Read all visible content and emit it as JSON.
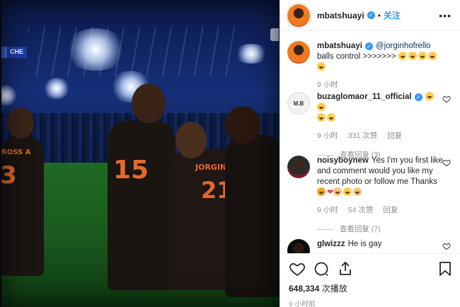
{
  "post": {
    "username": "mbatshuayi",
    "follow_label": "关注",
    "more_label": "•••",
    "dot": "•"
  },
  "media": {
    "score_team_a": "",
    "score_team_b": "CHE",
    "shirt_number_left": "3",
    "shirt_name_left": "ROSS A",
    "shirt_number_center": "15",
    "shirt_name_right": "JORGINHO",
    "shirt_number_right": "21"
  },
  "caption": {
    "username": "mbatshuayi",
    "mention": "@jorginhofrello",
    "text": " balls control >>>>>>> ",
    "time": "9 小时"
  },
  "comments": [
    {
      "username": "buzaglomaor_11_official",
      "text": "",
      "time": "9 小时",
      "likes": "331 次赞",
      "reply": "回复",
      "view_replies": "查看回复 (3)"
    },
    {
      "username": "noisyboynew",
      "text": "Yes I'm you first like and comment  would you like my recent photo  or follow me Thanks ",
      "time": "9 小时",
      "likes": "54 次赞",
      "reply": "回复",
      "view_replies": "查看回复 (7)"
    },
    {
      "username": "glwizzz",
      "text": "He is gay"
    }
  ],
  "footer": {
    "views_count": "648,334",
    "views_label": "次播放",
    "timestamp": "9 小时前"
  },
  "colors": {
    "accent": "#3897f0",
    "meta_text": "#8e8e8e",
    "border": "#efefef",
    "like_red": "#ed4956"
  }
}
